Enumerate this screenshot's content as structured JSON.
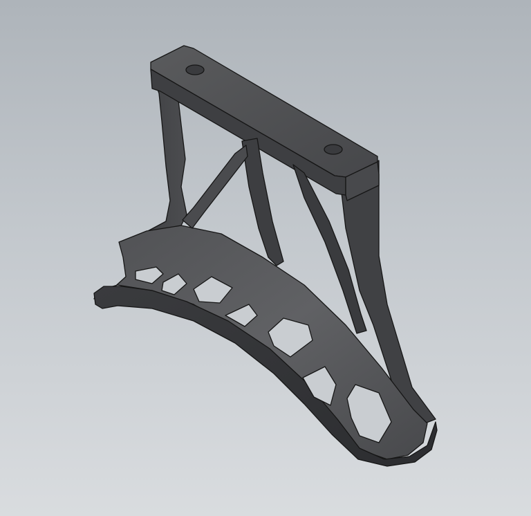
{
  "viewport": {
    "background_top": "#aeb4ba",
    "background_bottom": "#d9dcdf"
  },
  "model": {
    "body_color": "#4a4b4d",
    "edge_color": "#161616",
    "highlight_color": "#6b6c6e",
    "shadow_color": "#2e2f31"
  }
}
